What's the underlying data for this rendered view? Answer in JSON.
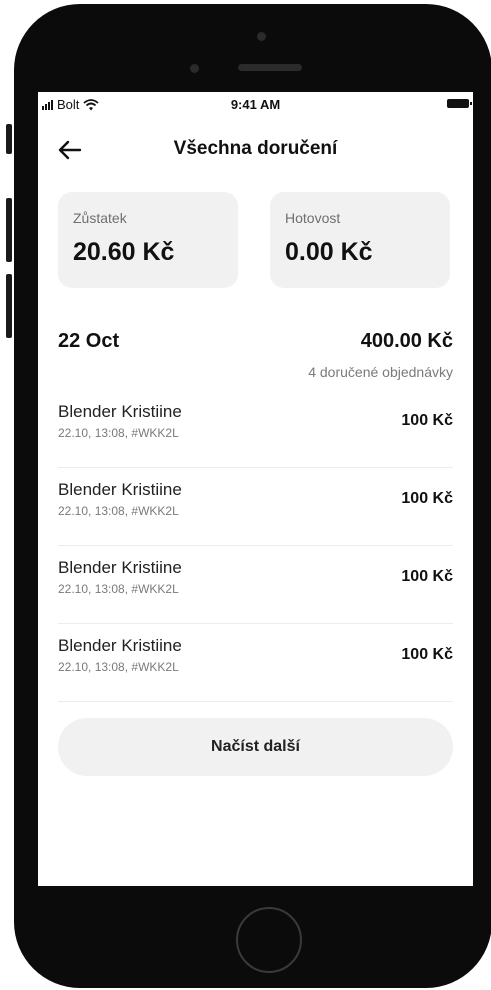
{
  "status_bar": {
    "carrier": "Bolt",
    "time": "9:41 AM"
  },
  "header": {
    "title": "Všechna doručení",
    "back_icon": "arrow-left-icon"
  },
  "balances": [
    {
      "label": "Zůstatek",
      "value": "20.60 Kč"
    },
    {
      "label": "Hotovost",
      "value": "0.00 Kč"
    }
  ],
  "day_group": {
    "date": "22 Oct",
    "total": "400.00 Kč",
    "count_text": "4 doručené objednávky"
  },
  "deliveries": [
    {
      "name": "Blender Kristiine",
      "meta": "22.10, 13:08, #WKK2L",
      "price": "100 Kč"
    },
    {
      "name": "Blender Kristiine",
      "meta": "22.10, 13:08, #WKK2L",
      "price": "100 Kč"
    },
    {
      "name": "Blender Kristiine",
      "meta": "22.10, 13:08, #WKK2L",
      "price": "100 Kč"
    },
    {
      "name": "Blender Kristiine",
      "meta": "22.10, 13:08, #WKK2L",
      "price": "100 Kč"
    }
  ],
  "load_more_label": "Načíst další"
}
